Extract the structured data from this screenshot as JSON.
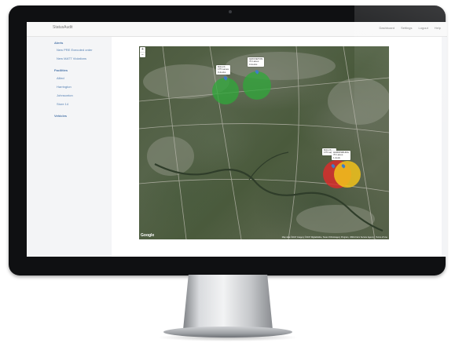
{
  "app": {
    "brand": "StatusAudit",
    "nav": [
      "Dashboard",
      "Settings",
      "Logout",
      "Help"
    ]
  },
  "sidebar": {
    "alerts_header": "Alerts",
    "alerts": [
      "New PRE Executed order",
      "New MATT Violations"
    ],
    "facilities_header": "Facilities",
    "facilities": [
      "Allied",
      "Harrington",
      "Johnsonton",
      "Store 14"
    ],
    "vehicles_header": "Vehicles"
  },
  "map": {
    "zoom_in": "+",
    "zoom_out": "−",
    "provider": "Google",
    "attribution": "Map data ©2017 Imagery ©2017 DigitalGlobe, Texas Orthoimagery Program, USDA Farm Service Agency · Terms of Use",
    "markers": [
      {
        "name": "DALLS",
        "lines": [
          "DALLS",
          "175 Lanes",
          "0 docks"
        ],
        "status": "green"
      },
      {
        "name": "GROVETON",
        "lines": [
          "GROVETON",
          "70 Lanes",
          "0 docks"
        ],
        "status": "green"
      },
      {
        "name": "DALLS",
        "lines": [
          "DALLS",
          "175 Lanes"
        ],
        "status": "red"
      },
      {
        "name": "HARRISBURG",
        "lines": [
          "HARRISBURG",
          "70 Lanes",
          "1 dock"
        ],
        "status": "yellow"
      }
    ],
    "colors": {
      "green": "#2fa83a",
      "red": "#e02a2a",
      "yellow": "#f1c21b",
      "pin": "#3d7ec9"
    }
  }
}
